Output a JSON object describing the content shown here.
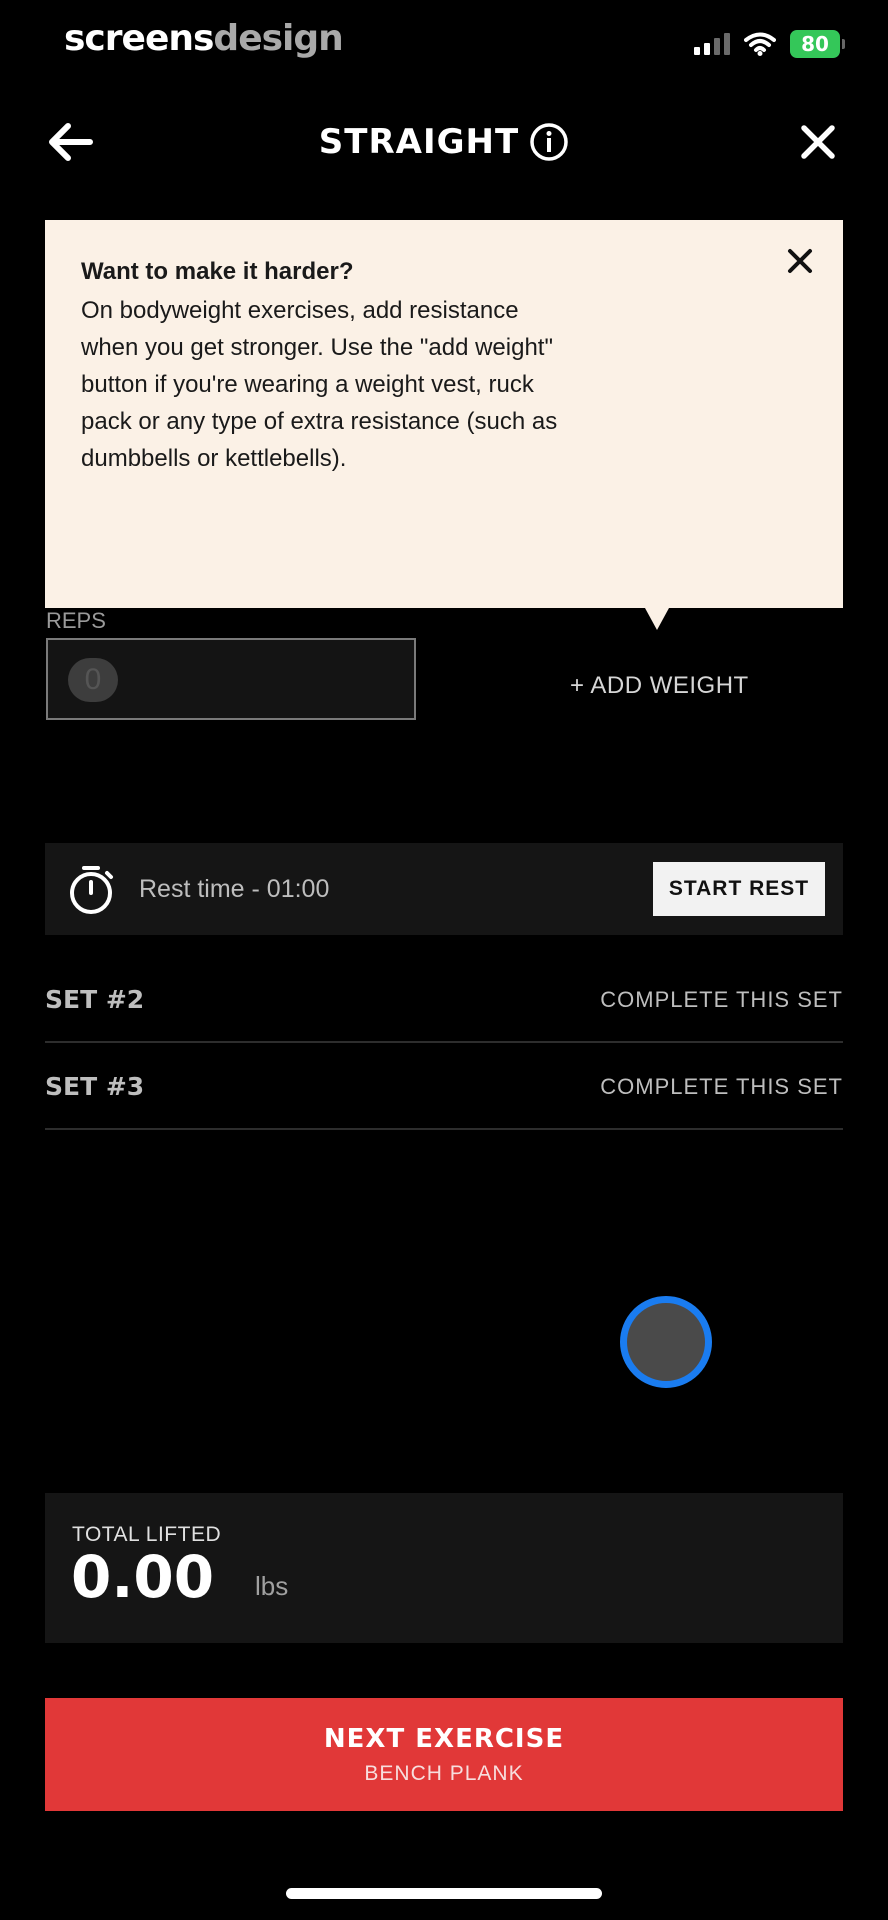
{
  "watermark": {
    "part1": "screens",
    "part2": "design"
  },
  "status_bar": {
    "battery": "80",
    "icons": [
      "signal-icon",
      "wifi-icon",
      "battery-icon"
    ]
  },
  "nav": {
    "title": "STRAIGHT",
    "back_icon": "arrow-left-icon",
    "info_icon": "info-icon",
    "close_icon": "close-icon"
  },
  "tooltip": {
    "title": "Want to make it harder?",
    "body": "On bodyweight exercises, add resistance when you get stronger. Use the \"add weight\" button if you're wearing a weight vest, ruck pack or any type of extra resistance (such as dumbbells or kettlebells).",
    "close_icon": "close-icon"
  },
  "reps": {
    "label": "REPS",
    "value": "0"
  },
  "add_weight": {
    "label": "+ ADD WEIGHT"
  },
  "rest": {
    "text": "Rest time - 01:00",
    "button": "START REST",
    "icon": "stopwatch-icon"
  },
  "sets": [
    {
      "label": "SET #2",
      "action": "COMPLETE THIS SET"
    },
    {
      "label": "SET #3",
      "action": "COMPLETE THIS SET"
    }
  ],
  "total": {
    "label": "TOTAL LIFTED",
    "value": "0.00",
    "unit": "lbs"
  },
  "next": {
    "label": "NEXT EXERCISE",
    "sub": "BENCH PLANK"
  },
  "colors": {
    "accent": "#e13838",
    "tooltip_bg": "#fbf1e6",
    "panel_bg": "#151515",
    "touch_ring": "#1a7cf0"
  }
}
